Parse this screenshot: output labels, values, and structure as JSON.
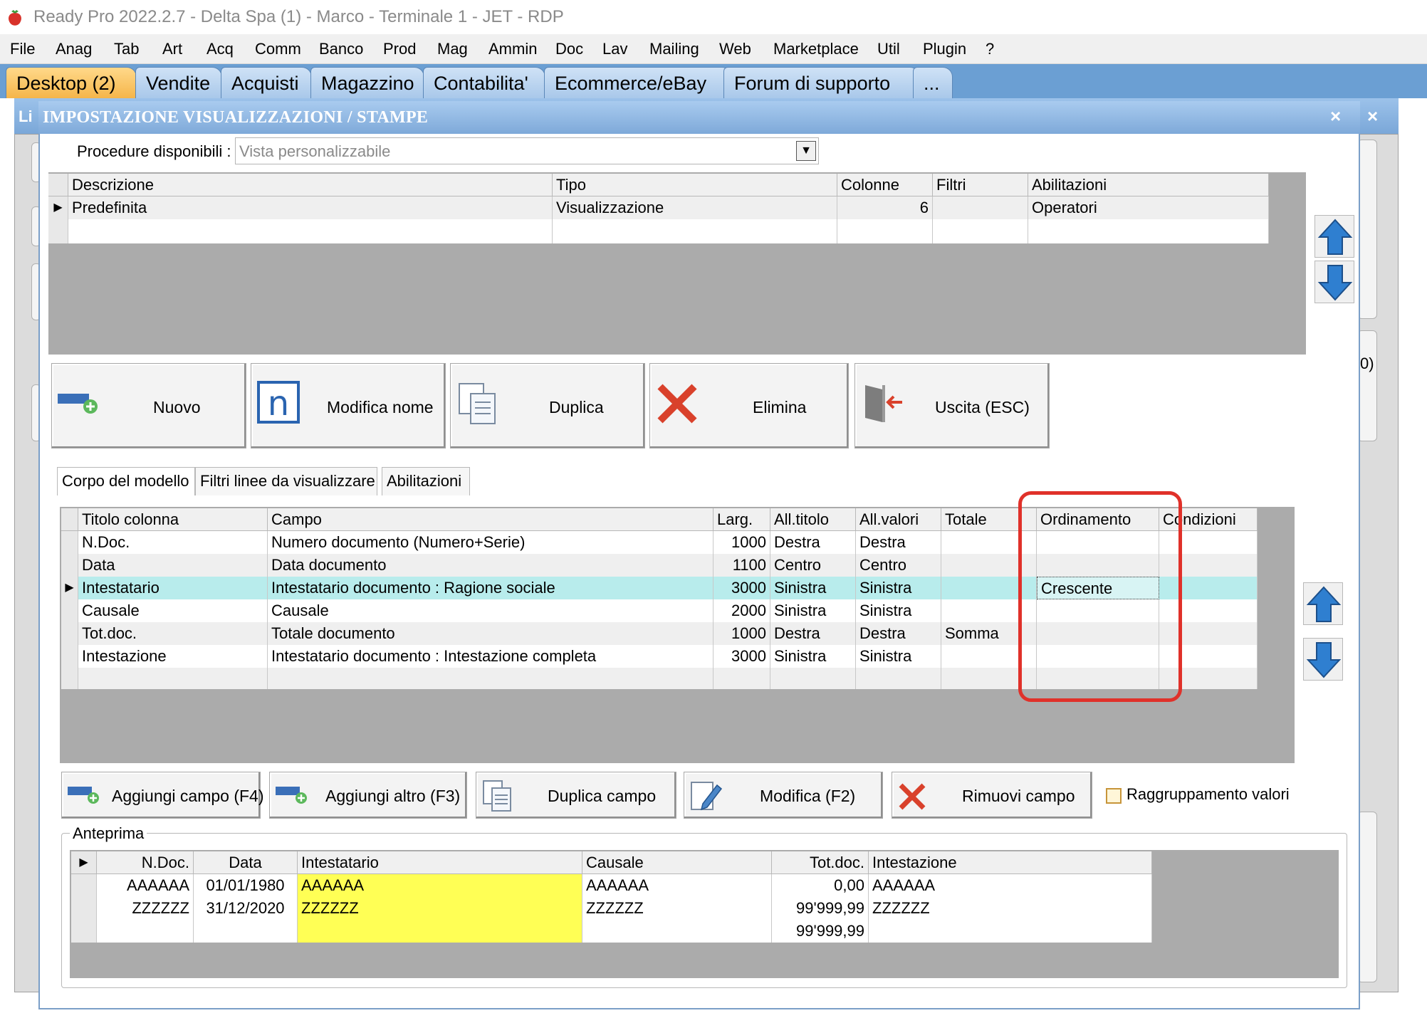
{
  "window": {
    "title": "Ready Pro 2022.2.7 - Delta Spa (1) - Marco - Terminale 1 - JET - RDP"
  },
  "menu": [
    "File",
    "Anag",
    "Tab",
    "Art",
    "Acq",
    "Comm",
    "Banco",
    "Prod",
    "Mag",
    "Ammin",
    "Doc",
    "Lav",
    "Mailing",
    "Web",
    "Marketplace",
    "Util",
    "Plugin",
    "?"
  ],
  "tabs": [
    "Desktop (2)",
    "Vendite",
    "Acquisti",
    "Magazzino",
    "Contabilita'",
    "Ecommerce/eBay",
    "Forum di supporto",
    "..."
  ],
  "background_dialog": {
    "partial_title": "Li",
    "close_glyph": "×",
    "partial_text": "0)"
  },
  "dialog": {
    "title": "IMPOSTAZIONE VISUALIZZAZIONI / STAMPE",
    "close_glyph": "×",
    "procedure_label": "Procedure disponibili :",
    "procedure_value": "Vista personalizzabile"
  },
  "models_table": {
    "columns": [
      "Descrizione",
      "Tipo",
      "Colonne",
      "Filtri",
      "Abilitazioni"
    ],
    "rows": [
      [
        "Predefinita",
        "Visualizzazione",
        "6",
        "",
        "Operatori"
      ]
    ]
  },
  "main_buttons": {
    "new": "Nuovo",
    "rename": "Modifica nome",
    "duplicate": "Duplica",
    "delete": "Elimina",
    "exit": "Uscita (ESC)"
  },
  "sub_tabs": [
    "Corpo del modello",
    "Filtri linee da visualizzare",
    "Abilitazioni"
  ],
  "fields_table": {
    "columns": [
      "Titolo colonna",
      "Campo",
      "Larg.",
      "All.titolo",
      "All.valori",
      "Totale",
      "Ordinamento",
      "Condizioni"
    ],
    "rows": [
      [
        "N.Doc.",
        "Numero documento (Numero+Serie)",
        "1000",
        "Destra",
        "Destra",
        "",
        "",
        ""
      ],
      [
        "Data",
        "Data documento",
        "1100",
        "Centro",
        "Centro",
        "",
        "",
        ""
      ],
      [
        "Intestatario",
        "Intestatario documento : Ragione sociale",
        "3000",
        "Sinistra",
        "Sinistra",
        "",
        "Crescente",
        ""
      ],
      [
        "Causale",
        "Causale",
        "2000",
        "Sinistra",
        "Sinistra",
        "",
        "",
        ""
      ],
      [
        "Tot.doc.",
        "Totale documento",
        "1000",
        "Destra",
        "Destra",
        "Somma",
        "",
        ""
      ],
      [
        "Intestazione",
        "Intestatario documento : Intestazione completa",
        "3000",
        "Sinistra",
        "Sinistra",
        "",
        "",
        ""
      ]
    ]
  },
  "field_buttons": {
    "add_field": "Aggiungi campo (F4)",
    "add_other": "Aggiungi altro (F3)",
    "duplicate_field": "Duplica campo",
    "edit": "Modifica (F2)",
    "remove": "Rimuovi campo",
    "group_values": "Raggruppamento valori"
  },
  "preview": {
    "label": "Anteprima",
    "columns": [
      "N.Doc.",
      "Data",
      "Intestatario",
      "Causale",
      "Tot.doc.",
      "Intestazione"
    ],
    "rows": [
      [
        "AAAAAA",
        "01/01/1980",
        "AAAAAA",
        "AAAAAA",
        "0,00",
        "AAAAAA"
      ],
      [
        "ZZZZZZ",
        "31/12/2020",
        "ZZZZZZ",
        "ZZZZZZ",
        "99'999,99",
        "ZZZZZZ"
      ],
      [
        "",
        "",
        "",
        "",
        "99'999,99",
        ""
      ]
    ],
    "highlight_color": "#ffff55"
  },
  "colors": {
    "tab_bar": "#6b9fd3",
    "active_tab": "#f5b54a",
    "selected_row": "#b8ecec",
    "highlight_box": "#e0312a",
    "arrow_blue": "#2f7fd0",
    "delete_red": "#d9412b"
  }
}
